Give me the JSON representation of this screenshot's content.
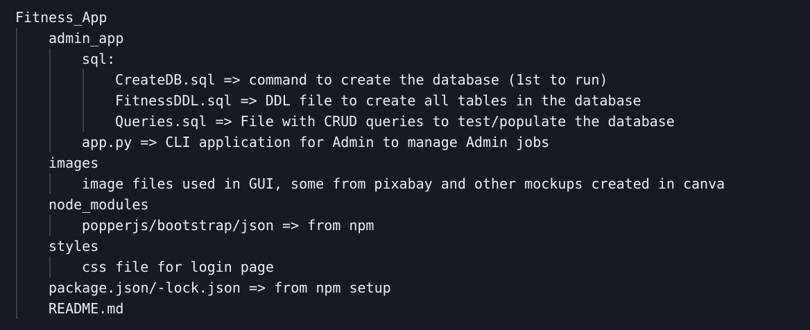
{
  "tree": {
    "root": "Fitness_App",
    "lines": [
      "admin_app",
      "sql:",
      "CreateDB.sql => command to create the database (1st to run)",
      "FitnessDDL.sql => DDL file to create all tables in the database",
      "Queries.sql => File with CRUD queries to test/populate the database",
      "app.py => CLI application for Admin to manage Admin jobs",
      "images",
      "image files used in GUI, some from pixabay and other mockups created in canva",
      "node_modules",
      "popperjs/bootstrap/json => from npm",
      "styles",
      "css file for login page",
      "package.json/-lock.json => from npm setup",
      "README.md"
    ]
  }
}
